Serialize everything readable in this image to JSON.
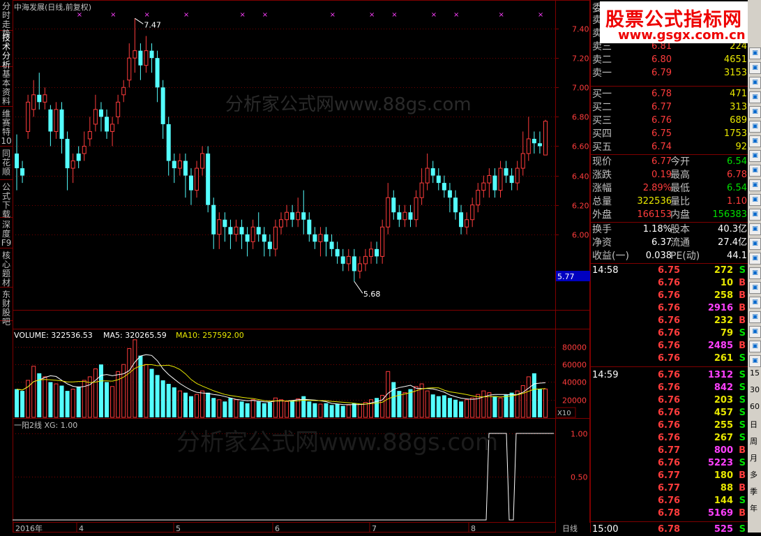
{
  "stock": {
    "name_label": "中海发展(日线,前复权)"
  },
  "left_tabs": [
    "分时走势",
    "技术分析",
    "基本资料",
    "维赛特10",
    "同花顺",
    "公式下载",
    "深度F9",
    "核心题材",
    "东财股吧"
  ],
  "price_axis": [
    "7.40",
    "7.20",
    "7.00",
    "6.80",
    "6.60",
    "6.40",
    "6.20",
    "6.00"
  ],
  "current_price_tag": "5.77",
  "high_label": "7.47",
  "low_label": "5.68",
  "watermark": "分析家公式网www.88gs.com",
  "volume_title": {
    "volume": "VOLUME: 322536.53",
    "ma5": "MA5: 320265.59",
    "ma10": "MA10: 257592.00"
  },
  "volume_axis": [
    "80000",
    "60000",
    "40000",
    "20000"
  ],
  "volume_unit": "X10",
  "indicator_title": "一阳2线 XG: 1.00",
  "indicator_axis": [
    "1.00",
    "0.50"
  ],
  "x_axis": [
    "2016年",
    "4",
    "5",
    "6",
    "7",
    "8"
  ],
  "period_label": "日线",
  "logo": {
    "line1": "股票公式指标网",
    "line2": "www.gsgx.com.cn"
  },
  "order_book": {
    "header": "委",
    "asks": [
      {
        "label": "卖五",
        "price": "",
        "vol": ""
      },
      {
        "label": "卖四",
        "price": "",
        "vol": ""
      },
      {
        "label": "卖三",
        "price": "6.81",
        "vol": "224"
      },
      {
        "label": "卖二",
        "price": "6.80",
        "vol": "4651"
      },
      {
        "label": "卖一",
        "price": "6.79",
        "vol": "3153"
      }
    ],
    "bids": [
      {
        "label": "买一",
        "price": "6.78",
        "vol": "471"
      },
      {
        "label": "买二",
        "price": "6.77",
        "vol": "313"
      },
      {
        "label": "买三",
        "price": "6.76",
        "vol": "689"
      },
      {
        "label": "买四",
        "price": "6.75",
        "vol": "1753"
      },
      {
        "label": "买五",
        "price": "6.74",
        "vol": "92"
      }
    ]
  },
  "quote": [
    {
      "l1": "现价",
      "v1": "6.77",
      "c1": "red",
      "l2": "今开",
      "v2": "6.54",
      "c2": "green"
    },
    {
      "l1": "涨跌",
      "v1": "0.19",
      "c1": "red",
      "l2": "最高",
      "v2": "6.78",
      "c2": "red"
    },
    {
      "l1": "涨幅",
      "v1": "2.89%",
      "c1": "red",
      "l2": "最低",
      "v2": "6.54",
      "c2": "green"
    },
    {
      "l1": "总量",
      "v1": "322536",
      "c1": "yellow",
      "l2": "量比",
      "v2": "1.10",
      "c2": "red"
    },
    {
      "l1": "外盘",
      "v1": "166153",
      "c1": "red",
      "l2": "内盘",
      "v2": "156383",
      "c2": "green"
    }
  ],
  "fundamentals": [
    {
      "l1": "换手",
      "v1": "1.18%",
      "l2": "股本",
      "v2": "40.3亿"
    },
    {
      "l1": "净资",
      "v1": "6.37",
      "l2": "流通",
      "v2": "27.4亿"
    },
    {
      "l1": "收益(一)",
      "v1": "0.038",
      "l2": "PE(动)",
      "v2": "44.1"
    }
  ],
  "ticks": [
    {
      "time": "14:58",
      "price": "6.75",
      "vol": "272",
      "side": "S"
    },
    {
      "time": "",
      "price": "6.76",
      "vol": "10",
      "side": "B"
    },
    {
      "time": "",
      "price": "6.76",
      "vol": "258",
      "side": "B"
    },
    {
      "time": "",
      "price": "6.76",
      "vol": "2916",
      "side": "B"
    },
    {
      "time": "",
      "price": "6.76",
      "vol": "232",
      "side": "B"
    },
    {
      "time": "",
      "price": "6.76",
      "vol": "79",
      "side": "S"
    },
    {
      "time": "",
      "price": "6.76",
      "vol": "2485",
      "side": "B"
    },
    {
      "time": "",
      "price": "6.76",
      "vol": "261",
      "side": "S"
    },
    {
      "time": "14:59",
      "price": "6.76",
      "vol": "1312",
      "side": "S"
    },
    {
      "time": "",
      "price": "6.76",
      "vol": "842",
      "side": "S"
    },
    {
      "time": "",
      "price": "6.76",
      "vol": "203",
      "side": "S"
    },
    {
      "time": "",
      "price": "6.76",
      "vol": "457",
      "side": "S"
    },
    {
      "time": "",
      "price": "6.76",
      "vol": "255",
      "side": "S"
    },
    {
      "time": "",
      "price": "6.76",
      "vol": "267",
      "side": "S"
    },
    {
      "time": "",
      "price": "6.77",
      "vol": "800",
      "side": "B"
    },
    {
      "time": "",
      "price": "6.76",
      "vol": "5223",
      "side": "S"
    },
    {
      "time": "",
      "price": "6.77",
      "vol": "180",
      "side": "B"
    },
    {
      "time": "",
      "price": "6.77",
      "vol": "88",
      "side": "B"
    },
    {
      "time": "",
      "price": "6.76",
      "vol": "144",
      "side": "S"
    },
    {
      "time": "",
      "price": "6.78",
      "vol": "5169",
      "side": "B"
    },
    {
      "time": "15:00",
      "price": "6.78",
      "vol": "525",
      "side": "S"
    }
  ],
  "right_strip": [
    "15",
    "30",
    "60",
    "日",
    "周",
    "月",
    "多",
    "季",
    "年"
  ],
  "colors": {
    "up": "#ff3c3c",
    "down": "#54ffff",
    "frame": "#800000",
    "ma5": "#ffffff",
    "ma10": "#e8e800"
  },
  "chart_data": {
    "type": "candlestick",
    "price_range": [
      5.6,
      7.5
    ],
    "candles": [
      [
        6.55,
        6.45,
        6.68,
        6.3
      ],
      [
        6.45,
        6.4,
        6.5,
        6.35
      ],
      [
        6.7,
        6.9,
        6.95,
        6.65
      ],
      [
        6.85,
        6.95,
        7.05,
        6.8
      ],
      [
        6.95,
        6.9,
        7.1,
        6.85
      ],
      [
        6.9,
        6.95,
        7.0,
        6.85
      ],
      [
        6.85,
        6.7,
        6.88,
        6.6
      ],
      [
        6.7,
        6.85,
        6.9,
        6.65
      ],
      [
        6.85,
        6.65,
        6.9,
        6.55
      ],
      [
        6.65,
        6.45,
        6.7,
        6.3
      ],
      [
        6.45,
        6.5,
        6.55,
        6.35
      ],
      [
        6.55,
        6.5,
        6.6,
        6.45
      ],
      [
        6.55,
        6.6,
        6.7,
        6.5
      ],
      [
        6.65,
        6.7,
        6.8,
        6.6
      ],
      [
        6.75,
        6.85,
        6.95,
        6.7
      ],
      [
        6.85,
        6.8,
        6.9,
        6.7
      ],
      [
        6.8,
        6.7,
        6.85,
        6.65
      ],
      [
        6.7,
        6.75,
        6.8,
        6.6
      ],
      [
        6.8,
        6.9,
        6.95,
        6.75
      ],
      [
        6.95,
        7.0,
        7.05,
        6.9
      ],
      [
        7.05,
        7.2,
        7.3,
        7.0
      ],
      [
        7.2,
        7.25,
        7.47,
        7.1
      ],
      [
        7.25,
        7.15,
        7.3,
        7.05
      ],
      [
        7.15,
        7.25,
        7.35,
        7.1
      ],
      [
        7.25,
        7.2,
        7.3,
        7.1
      ],
      [
        7.2,
        7.0,
        7.25,
        6.9
      ],
      [
        7.0,
        6.75,
        7.05,
        6.65
      ],
      [
        6.75,
        6.5,
        6.8,
        6.4
      ],
      [
        6.5,
        6.45,
        6.55,
        6.35
      ],
      [
        6.45,
        6.5,
        6.55,
        6.4
      ],
      [
        6.5,
        6.4,
        6.55,
        6.25
      ],
      [
        6.4,
        6.3,
        6.45,
        6.2
      ],
      [
        6.3,
        6.45,
        6.5,
        6.25
      ],
      [
        6.45,
        6.55,
        6.6,
        6.4
      ],
      [
        6.55,
        6.2,
        6.6,
        6.15
      ],
      [
        6.2,
        6.0,
        6.25,
        5.9
      ],
      [
        6.0,
        6.1,
        6.15,
        5.9
      ],
      [
        6.1,
        6.05,
        6.15,
        5.95
      ],
      [
        6.05,
        6.0,
        6.1,
        5.9
      ],
      [
        6.0,
        6.05,
        6.1,
        5.95
      ],
      [
        6.05,
        6.0,
        6.1,
        5.9
      ],
      [
        6.0,
        5.95,
        6.05,
        5.85
      ],
      [
        5.95,
        6.05,
        6.1,
        5.9
      ],
      [
        6.05,
        6.0,
        6.15,
        5.95
      ],
      [
        6.0,
        5.95,
        6.05,
        5.85
      ],
      [
        5.95,
        5.9,
        6.0,
        5.85
      ],
      [
        5.9,
        6.05,
        6.1,
        5.85
      ],
      [
        6.05,
        6.1,
        6.15,
        6.0
      ],
      [
        6.1,
        6.15,
        6.2,
        6.05
      ],
      [
        6.15,
        6.1,
        6.2,
        6.05
      ],
      [
        6.1,
        6.15,
        6.25,
        6.05
      ],
      [
        6.15,
        6.1,
        6.3,
        6.0
      ],
      [
        6.1,
        6.0,
        6.15,
        5.95
      ],
      [
        6.0,
        5.95,
        6.05,
        5.9
      ],
      [
        5.95,
        6.0,
        6.05,
        5.85
      ],
      [
        6.0,
        5.95,
        6.05,
        5.85
      ],
      [
        5.95,
        5.9,
        6.0,
        5.85
      ],
      [
        5.9,
        5.85,
        5.95,
        5.8
      ],
      [
        5.85,
        5.8,
        5.9,
        5.75
      ],
      [
        5.8,
        5.85,
        5.9,
        5.75
      ],
      [
        5.85,
        5.75,
        5.9,
        5.68
      ],
      [
        5.75,
        5.8,
        5.85,
        5.7
      ],
      [
        5.8,
        5.85,
        5.9,
        5.75
      ],
      [
        5.85,
        5.9,
        5.95,
        5.8
      ],
      [
        5.9,
        5.85,
        5.95,
        5.8
      ],
      [
        5.85,
        6.05,
        6.1,
        5.8
      ],
      [
        6.05,
        6.25,
        6.35,
        6.0
      ],
      [
        6.25,
        6.15,
        6.3,
        6.1
      ],
      [
        6.15,
        6.1,
        6.2,
        6.05
      ],
      [
        6.1,
        6.15,
        6.2,
        6.05
      ],
      [
        6.15,
        6.1,
        6.2,
        6.05
      ],
      [
        6.1,
        6.25,
        6.3,
        6.05
      ],
      [
        6.25,
        6.35,
        6.45,
        6.2
      ],
      [
        6.35,
        6.45,
        6.55,
        6.3
      ],
      [
        6.45,
        6.4,
        6.5,
        6.35
      ],
      [
        6.4,
        6.35,
        6.45,
        6.3
      ],
      [
        6.35,
        6.3,
        6.4,
        6.25
      ],
      [
        6.3,
        6.25,
        6.35,
        6.15
      ],
      [
        6.25,
        6.15,
        6.3,
        6.1
      ],
      [
        6.15,
        6.05,
        6.2,
        6.0
      ],
      [
        6.05,
        6.1,
        6.15,
        6.0
      ],
      [
        6.1,
        6.2,
        6.25,
        6.05
      ],
      [
        6.2,
        6.3,
        6.35,
        6.15
      ],
      [
        6.3,
        6.35,
        6.4,
        6.25
      ],
      [
        6.35,
        6.4,
        6.45,
        6.25
      ],
      [
        6.4,
        6.3,
        6.45,
        6.25
      ],
      [
        6.3,
        6.45,
        6.5,
        6.25
      ],
      [
        6.45,
        6.4,
        6.5,
        6.35
      ],
      [
        6.4,
        6.35,
        6.45,
        6.3
      ],
      [
        6.35,
        6.45,
        6.5,
        6.3
      ],
      [
        6.45,
        6.55,
        6.7,
        6.4
      ],
      [
        6.55,
        6.65,
        6.8,
        6.5
      ],
      [
        6.65,
        6.62,
        6.7,
        6.55
      ],
      [
        6.62,
        6.6,
        6.7,
        6.55
      ],
      [
        6.54,
        6.77,
        6.78,
        6.54
      ]
    ],
    "volumes": [
      32000,
      30000,
      42000,
      58000,
      50000,
      46000,
      40000,
      38000,
      36000,
      30000,
      32000,
      35000,
      42000,
      46000,
      55000,
      60000,
      40000,
      35000,
      52000,
      60000,
      78000,
      88000,
      70000,
      60000,
      55000,
      48000,
      42000,
      38000,
      34000,
      30000,
      28000,
      24000,
      26000,
      30000,
      28000,
      22000,
      20000,
      18000,
      22000,
      20000,
      18000,
      16000,
      20000,
      18000,
      16000,
      17000,
      22000,
      20000,
      18000,
      19000,
      21000,
      24000,
      18000,
      16000,
      15000,
      16000,
      14000,
      15000,
      13000,
      14000,
      16000,
      15000,
      17000,
      20000,
      22000,
      25000,
      52000,
      40000,
      30000,
      28000,
      32000,
      35000,
      38000,
      30000,
      26000,
      24000,
      25000,
      22000,
      20000,
      18000,
      20000,
      22000,
      26000,
      30000,
      28000,
      24000,
      22000,
      26000,
      28000,
      30000,
      36000,
      46000,
      50000,
      32000,
      32200
    ]
  }
}
